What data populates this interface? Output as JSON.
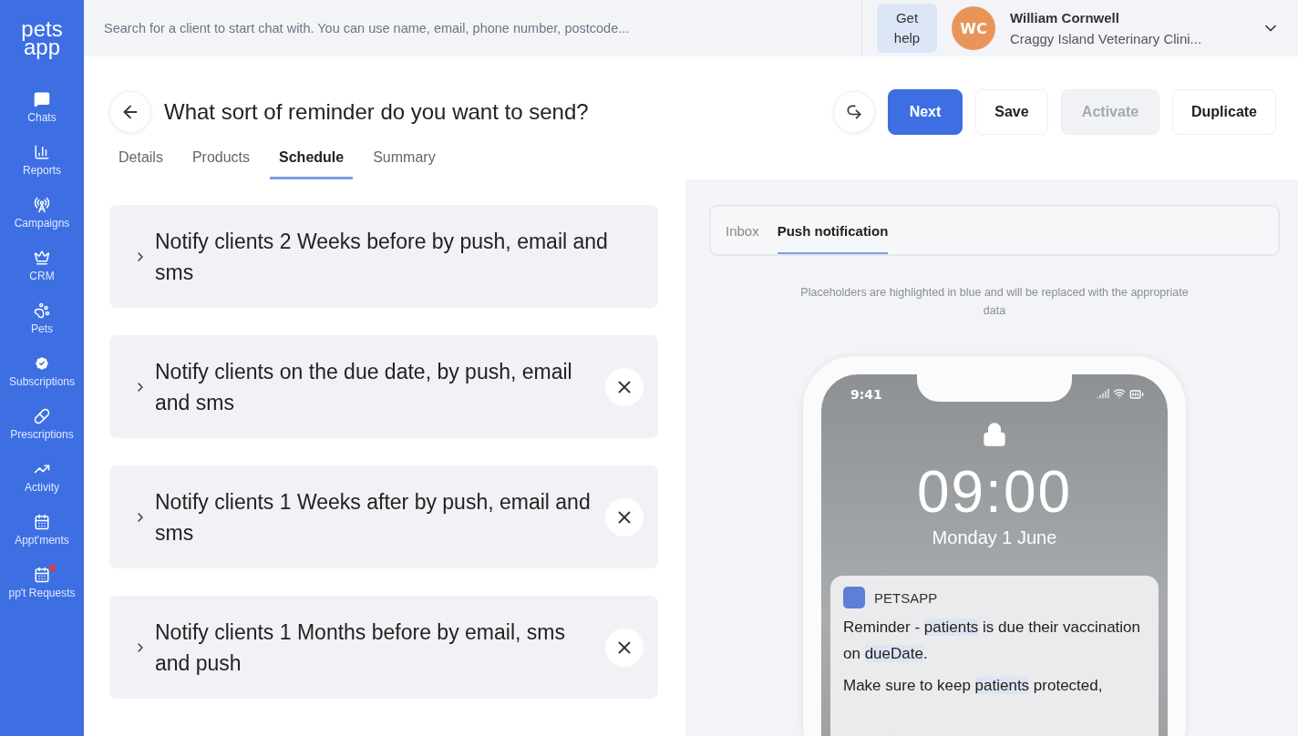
{
  "logo": {
    "line1": "pets",
    "line2": "app"
  },
  "nav": [
    {
      "label": "Chats",
      "kind": "chat",
      "alert": false
    },
    {
      "label": "Reports",
      "kind": "bars",
      "alert": false
    },
    {
      "label": "Campaigns",
      "kind": "antenna",
      "alert": false
    },
    {
      "label": "CRM",
      "kind": "crm",
      "alert": false
    },
    {
      "label": "Pets",
      "kind": "paw",
      "alert": false
    },
    {
      "label": "Subscriptions",
      "kind": "check",
      "alert": false
    },
    {
      "label": "Prescriptions",
      "kind": "pill",
      "alert": false
    },
    {
      "label": "Activity",
      "kind": "trend",
      "alert": false
    },
    {
      "label": "Appt'ments",
      "kind": "calendar",
      "alert": false
    },
    {
      "label": "pp't Requests",
      "kind": "calendar",
      "alert": true
    }
  ],
  "search": {
    "placeholder": "Search for a client to start chat with. You can use name, email, phone number, postcode..."
  },
  "help": {
    "line1": "Get",
    "line2": "help"
  },
  "user": {
    "initials": "WC",
    "name": "William Cornwell",
    "clinic": "Craggy Island Veterinary Clini..."
  },
  "page": {
    "title": "What sort of reminder do you want to send?"
  },
  "actions": [
    {
      "label": "Next",
      "kind": "primary",
      "disabled": false
    },
    {
      "label": "Save",
      "kind": "secondary",
      "disabled": false
    },
    {
      "label": "Activate",
      "kind": "secondary",
      "disabled": true
    },
    {
      "label": "Duplicate",
      "kind": "secondary",
      "disabled": false
    }
  ],
  "tabs": [
    {
      "label": "Details",
      "selected": false
    },
    {
      "label": "Products",
      "selected": false
    },
    {
      "label": "Schedule",
      "selected": true
    },
    {
      "label": "Summary",
      "selected": false
    }
  ],
  "reminders": [
    {
      "text": "Notify clients 2 Weeks before by push, email and sms",
      "removable": false
    },
    {
      "text": "Notify clients on the due date, by push, email and sms",
      "removable": true
    },
    {
      "text": "Notify clients 1 Weeks after by push, email and sms",
      "removable": true
    },
    {
      "text": "Notify clients 1 Months before by email, sms and push",
      "removable": true
    }
  ],
  "preview": {
    "tabs": [
      {
        "label": "Inbox",
        "selected": false
      },
      {
        "label": "Push notification",
        "selected": true
      }
    ],
    "hint": "Placeholders are highlighted in blue and will be replaced with the appropriate data",
    "phone": {
      "status_time": "9:41",
      "clock": "09:00",
      "date": "Monday 1 June",
      "notification": {
        "app": "PETSAPP",
        "paragraphs": [
          [
            {
              "text": "Reminder - ",
              "placeholder": false
            },
            {
              "text": "patients",
              "placeholder": true
            },
            {
              "text": " is due their vaccination on ",
              "placeholder": false
            },
            {
              "text": "dueDate",
              "placeholder": true
            },
            {
              "text": ".",
              "placeholder": false
            }
          ],
          [
            {
              "text": "Make sure to keep ",
              "placeholder": false
            },
            {
              "text": "patients",
              "placeholder": true
            },
            {
              "text": " protected,",
              "placeholder": false
            }
          ]
        ]
      }
    }
  }
}
